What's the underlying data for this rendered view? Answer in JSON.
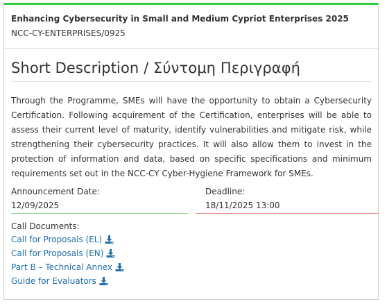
{
  "programme": {
    "title": "Enhancing Cybersecurity in Small and Medium Cypriot Enterprises 2025",
    "code": "NCC-CY-ENTERPRISES/0925"
  },
  "short_description": {
    "heading": "Short Description / Σύντομη Περιγραφή",
    "text": "Through the Programme, SMEs will have the opportunity to obtain a Cybersecurity Certification. Following acquirement of the Certification, enterprises will be able to assess their current level of maturity, identify vulnerabilities and mitigate risk, while strengthening their cybersecurity practices. It will also allow them to invest in the protection of information and data, based on specific specifications and minimum requirements set out in the NCC-CY Cyber-Hygiene Framework for SMEs."
  },
  "dates": {
    "announcement_label": "Announcement Date:",
    "announcement_value": "12/09/2025",
    "deadline_label": "Deadline:",
    "deadline_value": "18/11/2025 13:00",
    "announcement_color": "#8fd68f",
    "deadline_color": "#e58a8a"
  },
  "call_documents": {
    "label": "Call Documents:",
    "items": [
      {
        "label": "Call for Proposals (EL)",
        "icon": "download-icon"
      },
      {
        "label": "Call for Proposals (EN)",
        "icon": "download-icon"
      },
      {
        "label": "Part B – Technical Annex",
        "icon": "download-icon"
      },
      {
        "label": "Guide for Evaluators",
        "icon": "download-icon"
      }
    ]
  },
  "colors": {
    "accent_top_border": "#2ecc40",
    "link": "#1f6fa8"
  }
}
